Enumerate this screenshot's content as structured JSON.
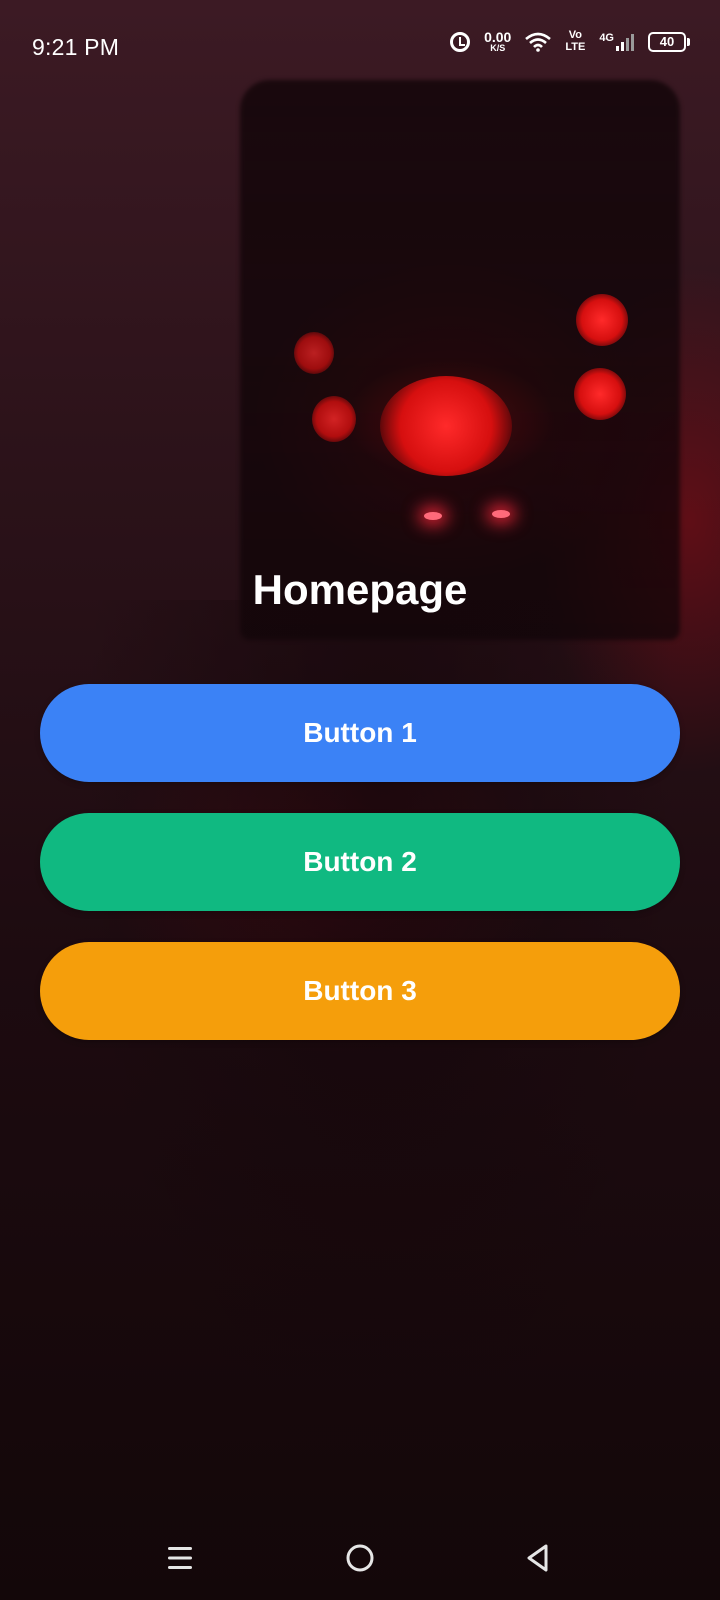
{
  "status_bar": {
    "time": "9:21 PM",
    "net_speed_value": "0.00",
    "net_speed_unit": "K/S",
    "volte_top": "Vo",
    "volte_bottom": "LTE",
    "network_type": "4G",
    "battery_level": "40",
    "icons": [
      "alarm-icon",
      "wifi-icon",
      "signal-icon",
      "battery-icon"
    ]
  },
  "main": {
    "title": "Homepage",
    "buttons": [
      {
        "label": "Button 1",
        "color": "#3b82f6"
      },
      {
        "label": "Button 2",
        "color": "#10b981"
      },
      {
        "label": "Button 3",
        "color": "#f59e0b"
      }
    ]
  },
  "nav_bar": {
    "icons": [
      "menu-icon",
      "home-icon",
      "back-icon"
    ]
  }
}
